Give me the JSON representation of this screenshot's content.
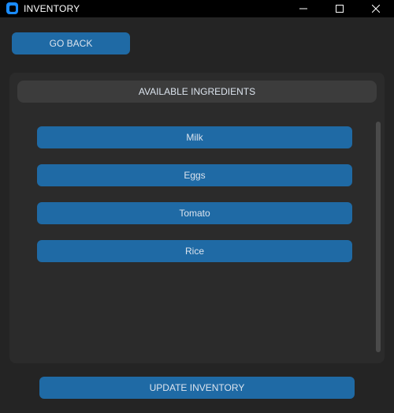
{
  "window": {
    "title": "INVENTORY",
    "icons": {
      "app": "app-icon",
      "minimize": "minimize-icon",
      "maximize": "maximize-icon",
      "close": "close-icon"
    }
  },
  "nav": {
    "back_label": "GO BACK"
  },
  "panel": {
    "header": "AVAILABLE INGREDIENTS",
    "items": [
      "Milk",
      "Eggs",
      "Tomato",
      "Rice"
    ]
  },
  "footer": {
    "update_label": "UPDATE INVENTORY"
  },
  "colors": {
    "accent": "#1f6aa5",
    "background": "#242424",
    "panel": "#2b2b2b",
    "header": "#3c3c3c",
    "titlebar": "#000000",
    "app_icon": "#1a8cff"
  }
}
